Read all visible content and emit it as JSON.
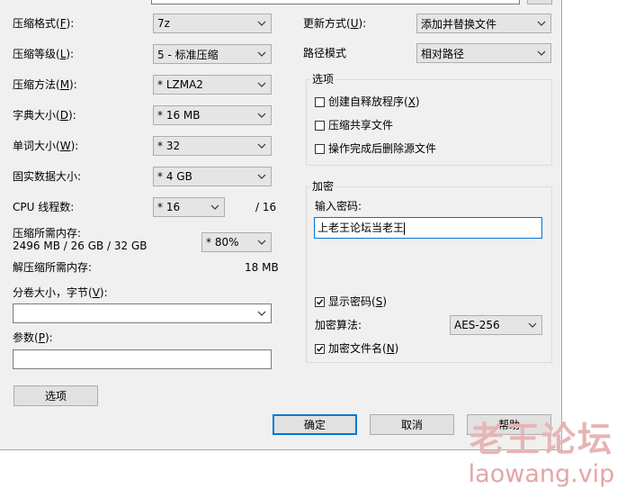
{
  "left": {
    "format": {
      "label": "压缩格式(",
      "key": "F",
      "tail": "):",
      "value": "7z"
    },
    "level": {
      "label": "压缩等级(",
      "key": "L",
      "tail": "):",
      "value": "5 - 标准压缩"
    },
    "method": {
      "label": "压缩方法(",
      "key": "M",
      "tail": "):",
      "value": "* LZMA2"
    },
    "dict": {
      "label": "字典大小(",
      "key": "D",
      "tail": "):",
      "value": "* 16 MB"
    },
    "word": {
      "label": "单词大小(",
      "key": "W",
      "tail": "):",
      "value": "* 32"
    },
    "solid": {
      "label": "固实数据大小:",
      "value": "* 4 GB"
    },
    "threads": {
      "label": "CPU 线程数:",
      "value": "* 16",
      "total": "/ 16"
    },
    "mem_compress": {
      "label": "压缩所需内存:",
      "detail": "2496 MB / 26 GB / 32 GB",
      "value": "* 80%"
    },
    "mem_decompress": {
      "label": "解压缩所需内存:",
      "value": "18 MB"
    },
    "volume": {
      "label": "分卷大小，字节(",
      "key": "V",
      "tail": "):",
      "value": ""
    },
    "params": {
      "label": "参数(",
      "key": "P",
      "tail": "):",
      "value": ""
    },
    "options_button": "选项"
  },
  "right": {
    "update": {
      "label": "更新方式(",
      "key": "U",
      "tail": "):",
      "value": "添加并替换文件"
    },
    "path": {
      "label": "路径模式",
      "value": "相对路径"
    },
    "options": {
      "title": "选项",
      "sfx": {
        "label": "创建自释放程序(",
        "key": "X",
        "tail": ")",
        "checked": false
      },
      "shared": {
        "label": "压缩共享文件",
        "checked": false
      },
      "delete": {
        "label": "操作完成后删除源文件",
        "checked": false
      }
    },
    "encryption": {
      "title": "加密",
      "password_label": "输入密码:",
      "password_value": "上老王论坛当老王",
      "show": {
        "label": "显示密码(",
        "key": "S",
        "tail": ")",
        "checked": true
      },
      "method_label": "加密算法:",
      "method_value": "AES-256",
      "names": {
        "label": "加密文件名(",
        "key": "N",
        "tail": ")",
        "checked": true
      }
    }
  },
  "buttons": {
    "ok": "确定",
    "cancel": "取消",
    "help": "帮助"
  },
  "watermark": {
    "cn": "老王论坛",
    "url": "laowang.vip"
  },
  "icons": {
    "dropdown": "chevron-down-icon",
    "check": "check-mark-icon"
  }
}
